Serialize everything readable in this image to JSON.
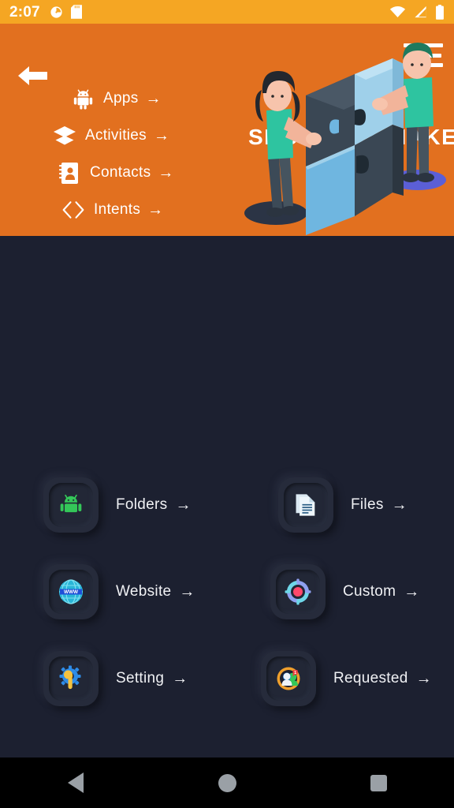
{
  "statusbar": {
    "time": "2:07",
    "left_icons": [
      "alarm-icon",
      "sd-card-icon"
    ],
    "right_icons": [
      "wifi-icon",
      "cellular-signal-icon",
      "battery-icon"
    ],
    "background": "#f5a623"
  },
  "header": {
    "background": "#e2701f",
    "title": "SHORTCUT MAKER",
    "back_label": "back-arrow",
    "menu_label": "menu",
    "menu_items": [
      {
        "label": "Apps",
        "arrow": "→",
        "icon": "android-robot-icon"
      },
      {
        "label": "Activities",
        "arrow": "→",
        "icon": "layers-icon"
      },
      {
        "label": "Contacts",
        "arrow": "→",
        "icon": "contact-book-icon"
      },
      {
        "label": "Intents",
        "arrow": "→",
        "icon": "code-brackets-icon"
      }
    ],
    "illustration": "two-people-assembling-puzzle-pieces"
  },
  "grid": {
    "background": "#1c2030",
    "rows": [
      [
        {
          "label": "Folders",
          "arrow": "→",
          "icon": "android-robot-icon"
        },
        {
          "label": "Files",
          "arrow": "→",
          "icon": "documents-icon"
        }
      ],
      [
        {
          "label": "Website",
          "arrow": "→",
          "icon": "globe-www-icon"
        },
        {
          "label": "Custom",
          "arrow": "→",
          "icon": "target-crosshair-icon"
        }
      ],
      [
        {
          "label": "Setting",
          "arrow": "→",
          "icon": "gear-wrench-icon"
        },
        {
          "label": "Requested",
          "arrow": "→",
          "icon": "people-group-icon"
        }
      ]
    ]
  },
  "navbar": {
    "background": "#000000",
    "buttons": [
      {
        "name": "back",
        "icon": "triangle-back-icon"
      },
      {
        "name": "home",
        "icon": "circle-home-icon"
      },
      {
        "name": "recents",
        "icon": "square-recents-icon"
      }
    ]
  }
}
